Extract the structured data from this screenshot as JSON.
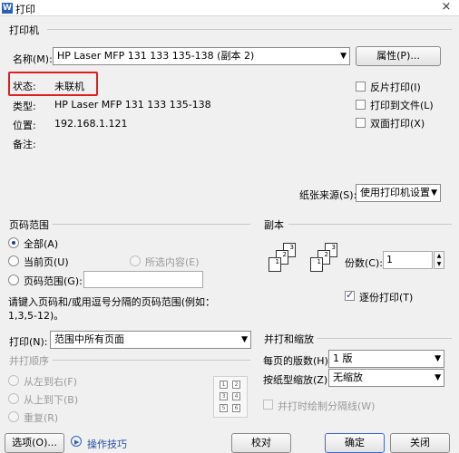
{
  "window": {
    "title": "打印",
    "app_icon": "W",
    "close": "×"
  },
  "printer_group": {
    "label": "打印机",
    "name_label": "名称(M):",
    "name_value": "HP Laser MFP 131 133 135-138 (副本 2)",
    "properties_button": "属性(P)...",
    "status_label": "状态:",
    "status_value": "未联机",
    "type_label": "类型:",
    "type_value": "HP Laser MFP 131 133 135-138",
    "location_label": "位置:",
    "location_value": "192.168.1.121",
    "comment_label": "备注:",
    "reverse_print": "反片打印(I)",
    "print_to_file": "打印到文件(L)",
    "duplex_print": "双面打印(X)",
    "paper_source_label": "纸张来源(S):",
    "paper_source_value": "使用打印机设置"
  },
  "page_range": {
    "label": "页码范围",
    "all": "全部(A)",
    "current": "当前页(U)",
    "selection": "所选内容(E)",
    "pages": "页码范围(G):",
    "hint": "请键入页码和/或用逗号分隔的页码范围(例如：",
    "hint2": "1,3,5-12)。"
  },
  "copies": {
    "label": "副本",
    "count_label": "份数(C):",
    "count_value": "1",
    "collate": "逐份打印(T)"
  },
  "print_what": {
    "label": "打印(N):",
    "value": "范围中所有页面"
  },
  "order": {
    "label": "并打顺序",
    "ltr": "从左到右(F)",
    "ttb": "从上到下(B)",
    "repeat": "重复(R)"
  },
  "zoom": {
    "label": "并打和缩放",
    "pages_per_sheet_label": "每页的版数(H):",
    "pages_per_sheet_value": "1 版",
    "scale_label": "按纸型缩放(Z):",
    "scale_value": "无缩放",
    "draw_lines": "并打时绘制分隔线(W)"
  },
  "footer": {
    "options": "选项(O)...",
    "tips": "操作技巧",
    "proof": "校对",
    "ok": "确定",
    "close": "关闭"
  }
}
